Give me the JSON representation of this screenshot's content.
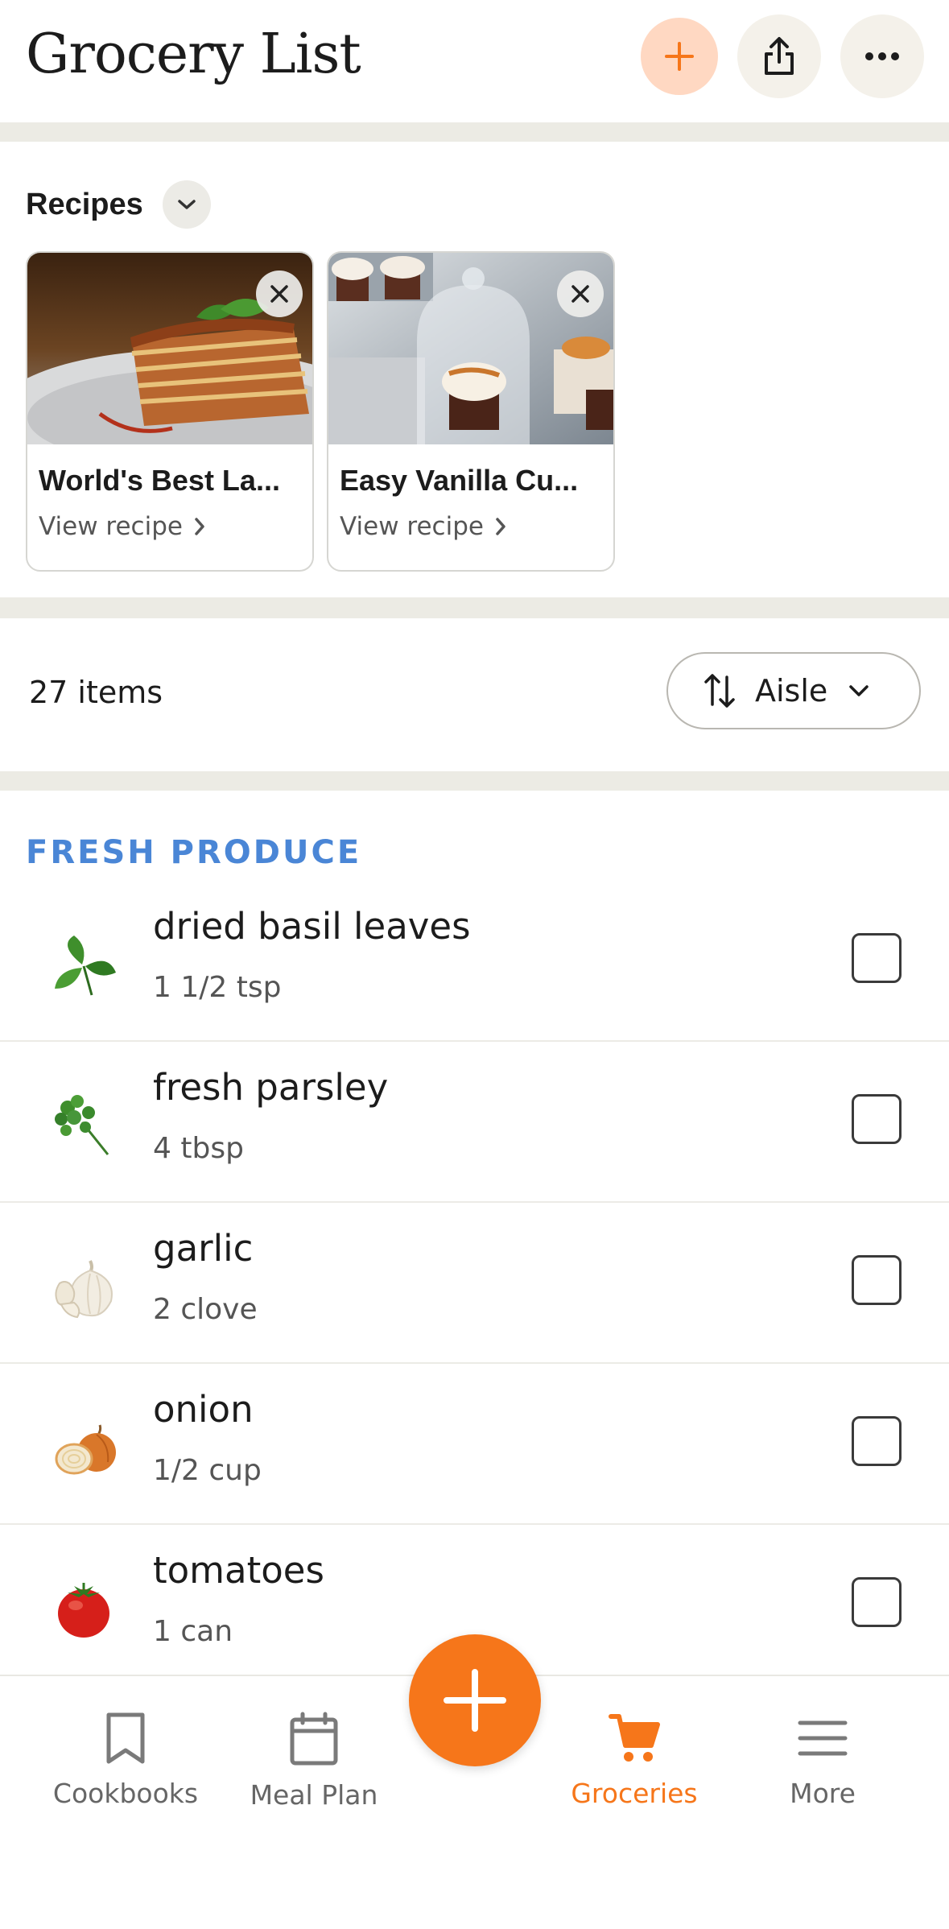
{
  "header": {
    "title": "Grocery List",
    "add_icon": "plus-icon",
    "share_icon": "share-icon",
    "more_icon": "ellipsis-icon"
  },
  "recipes": {
    "title": "Recipes",
    "toggle_icon": "chevron-down-icon",
    "items": [
      {
        "name": "World's Best La...",
        "link": "View recipe",
        "image": "lasagna-photo"
      },
      {
        "name": "Easy Vanilla Cu...",
        "link": "View recipe",
        "image": "cupcake-photo"
      }
    ]
  },
  "list_bar": {
    "count": "27 items",
    "sort_label": "Aisle",
    "sort_icon": "sort-arrows-icon"
  },
  "section": {
    "title": "FRESH PRODUCE",
    "items": [
      {
        "name": "dried basil leaves",
        "qty": "1 1/2 tsp",
        "icon": "basil-icon",
        "checked": false
      },
      {
        "name": "fresh parsley",
        "qty": "4 tbsp",
        "icon": "parsley-icon",
        "checked": false
      },
      {
        "name": "garlic",
        "qty": "2 clove",
        "icon": "garlic-icon",
        "checked": false
      },
      {
        "name": "onion",
        "qty": "1/2 cup",
        "icon": "onion-icon",
        "checked": false
      },
      {
        "name": "tomatoes",
        "qty": "1 can",
        "icon": "tomato-icon",
        "checked": false
      }
    ]
  },
  "bottom_nav": {
    "items": [
      {
        "label": "Cookbooks",
        "icon": "bookmark-icon",
        "active": false
      },
      {
        "label": "Meal Plan",
        "icon": "calendar-icon",
        "active": false
      },
      {
        "label": "Groceries",
        "icon": "cart-icon",
        "active": true
      },
      {
        "label": "More",
        "icon": "menu-icon",
        "active": false
      }
    ],
    "fab_icon": "plus-icon"
  },
  "colors": {
    "accent": "#f6761a",
    "section_title": "#4a86d6",
    "band": "#ecebe4"
  }
}
